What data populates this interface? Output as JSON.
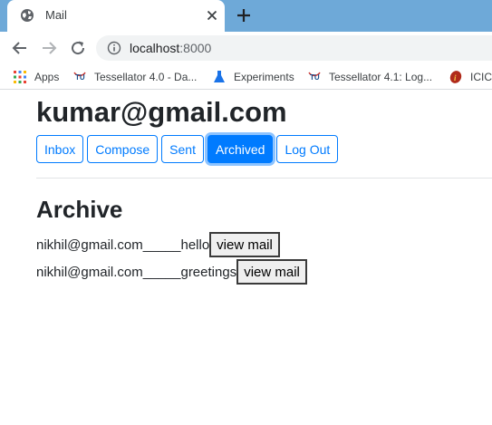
{
  "browser": {
    "tab_title": "Mail",
    "url_host": "localhost",
    "url_port": ":8000",
    "bookmarks": [
      {
        "label": "Apps",
        "icon": "apps-grid-icon"
      },
      {
        "label": "Tessellator 4.0 - Da...",
        "icon": "tessellator-logo-icon"
      },
      {
        "label": "Experiments",
        "icon": "flask-icon"
      },
      {
        "label": "Tessellator 4.1: Log...",
        "icon": "tessellator-logo-icon"
      },
      {
        "label": "ICICI",
        "icon": "icici-logo-icon"
      }
    ],
    "colors": {
      "tabstrip": "#6ea9d8",
      "primary": "#007bff"
    }
  },
  "page": {
    "user_email": "kumar@gmail.com",
    "nav_buttons": [
      {
        "label": "Inbox",
        "active": false
      },
      {
        "label": "Compose",
        "active": false
      },
      {
        "label": "Sent",
        "active": false
      },
      {
        "label": "Archived",
        "active": true
      },
      {
        "label": "Log Out",
        "active": false
      }
    ],
    "section_title": "Archive",
    "mails": [
      {
        "text": "nikhil@gmail.com_____hello",
        "button": "view mail"
      },
      {
        "text": "nikhil@gmail.com_____greetings",
        "button": "view mail"
      }
    ]
  }
}
